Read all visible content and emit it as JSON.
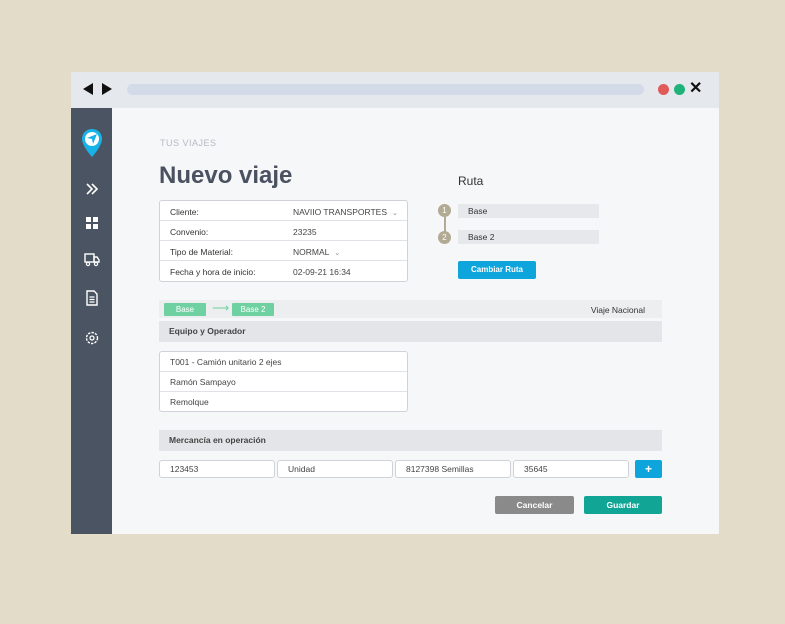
{
  "browser": {
    "icons": [
      "back-arrow-icon",
      "forward-arrow-icon",
      "close-icon"
    ],
    "colors": {
      "red_dot": "#e05a5a",
      "green_dot": "#1fb37a"
    }
  },
  "sidebar": {
    "icons": [
      "logo-pin-icon",
      "double-chevron-right-icon",
      "grid-icon",
      "truck-icon",
      "document-icon",
      "gear-icon"
    ],
    "background": "#4b5462"
  },
  "page": {
    "breadcrumb": "TUS VIAJES",
    "title": "Nuevo viaje"
  },
  "info": {
    "rows": [
      {
        "label": "Cliente:",
        "value": "NAVIIO TRANSPORTES"
      },
      {
        "label": "Convenio:",
        "value": "23235"
      },
      {
        "label": "Tipo de Material:",
        "value": "NORMAL"
      },
      {
        "label": "Fecha y hora de inicio:",
        "value": "02-09-21 16:34"
      }
    ]
  },
  "ruta": {
    "title": "Ruta",
    "stops": [
      {
        "num": "1",
        "name": "Base"
      },
      {
        "num": "2",
        "name": "Base 2"
      }
    ],
    "change_button": "Cambiar Ruta"
  },
  "route_strip": {
    "from": "Base",
    "arrow": "⟶",
    "to": "Base 2",
    "trip_type": "Viaje Nacional"
  },
  "equipo": {
    "header": "Equipo y Operador",
    "rows": [
      "T001 - Camión unitario 2 ejes",
      "Ramón Sampayo",
      "Remolque"
    ]
  },
  "mercancia": {
    "header": "Mercancía en operación",
    "fields": [
      "123453",
      "Unidad",
      "8127398 Semillas",
      "35645"
    ],
    "add_button": "+"
  },
  "actions": {
    "cancel": "Cancelar",
    "save": "Guardar"
  },
  "colors": {
    "accent_blue": "#0ea5dd",
    "accent_green": "#6fd1a2",
    "save_teal": "#11a596",
    "cancel_gray": "#8a8a8a",
    "route_marker": "#b2aa93"
  }
}
